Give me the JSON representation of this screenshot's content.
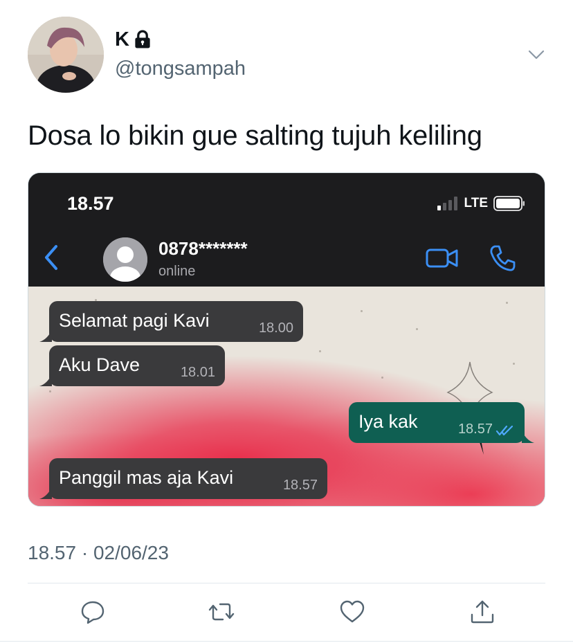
{
  "tweet": {
    "display_name": "K",
    "handle": "@tongsampah",
    "text": "Dosa lo bikin gue salting tujuh keliling",
    "timestamp": "18.57 · 02/06/23"
  },
  "screenshot": {
    "status_time": "18.57",
    "network": "LTE",
    "contact_name": "0878*******",
    "contact_status": "online",
    "messages": [
      {
        "text": "Selamat pagi Kavi",
        "time": "18.00",
        "direction": "incoming"
      },
      {
        "text": "Aku Dave",
        "time": "18.01",
        "direction": "incoming"
      },
      {
        "text": "Iya kak",
        "time": "18.57",
        "direction": "outgoing"
      },
      {
        "text": "Panggil mas aja Kavi",
        "time": "18.57",
        "direction": "incoming"
      }
    ]
  },
  "icons": {
    "lock": "lock-icon",
    "caret": "chevron-down-icon",
    "back": "back-arrow-icon",
    "video": "video-call-icon",
    "call": "phone-call-icon",
    "reply": "reply-icon",
    "retweet": "retweet-icon",
    "like": "heart-icon",
    "share": "share-icon"
  },
  "colors": {
    "accent": "#1d9bf0",
    "whatsapp_blue": "#3b8ff5",
    "outgoing_bubble": "#0f5f52",
    "incoming_bubble": "#3a3a3c",
    "muted_text": "#536471"
  }
}
